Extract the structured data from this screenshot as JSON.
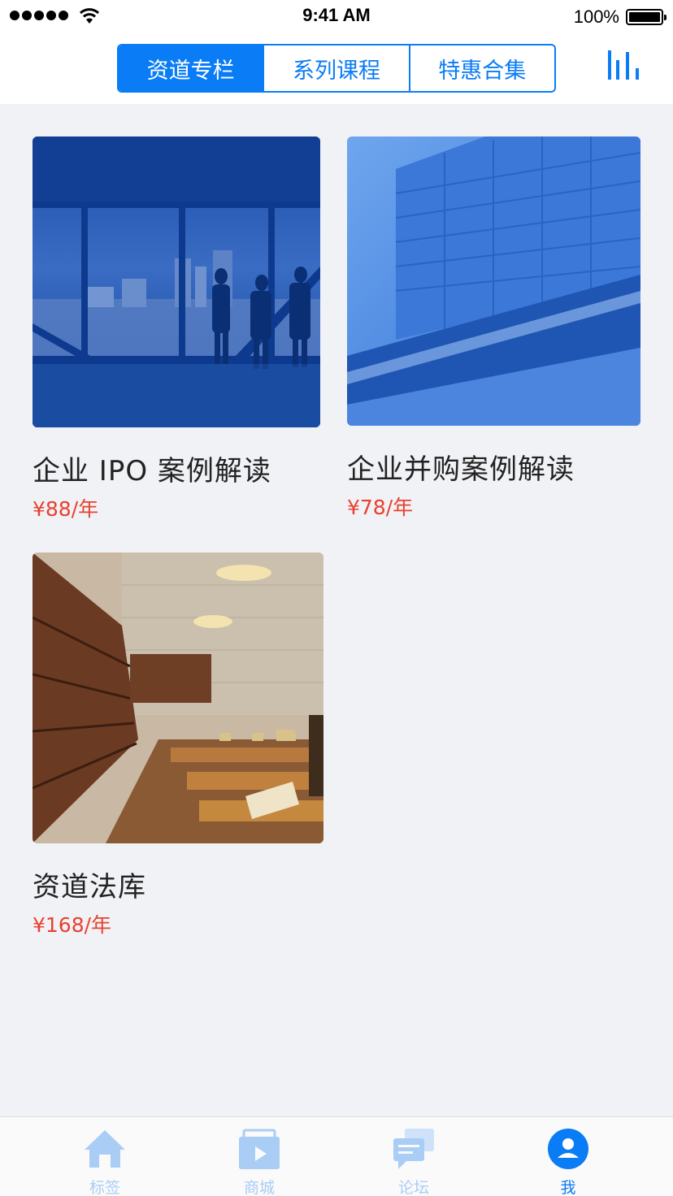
{
  "status_bar": {
    "time": "9:41 AM",
    "battery": "100%"
  },
  "nav": {
    "segments": [
      "资道专栏",
      "系列课程",
      "特惠合集"
    ],
    "active_segment": 0,
    "chart_icon": "bar-chart-icon"
  },
  "products": [
    {
      "title": "企业 IPO 案例解读",
      "price": "¥88/年",
      "image": "office-window-skyline-photo"
    },
    {
      "title": "企业并购案例解读",
      "price": "¥78/年",
      "image": "glass-building-photo"
    },
    {
      "title": "资道法库",
      "price": "¥168/年",
      "image": "library-reading-room-photo"
    }
  ],
  "tabbar": {
    "items": [
      {
        "label": "标签",
        "icon": "home-icon"
      },
      {
        "label": "商城",
        "icon": "store-icon"
      },
      {
        "label": "论坛",
        "icon": "chat-icon"
      },
      {
        "label": "我",
        "icon": "profile-icon"
      }
    ],
    "active": 3
  },
  "colors": {
    "accent": "#0a7cf6",
    "price": "#e8412f",
    "background": "#f1f2f6",
    "tab_inactive": "#a9cdf5"
  }
}
